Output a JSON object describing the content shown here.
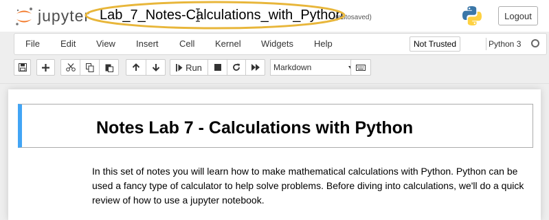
{
  "header": {
    "logo_text": "jupyter",
    "notebook_title": "Lab_7_Notes-Calculations_with_Python",
    "autosave_status": "(autosaved)",
    "logout_label": "Logout"
  },
  "menubar": {
    "items": [
      "File",
      "Edit",
      "View",
      "Insert",
      "Cell",
      "Kernel",
      "Widgets",
      "Help"
    ],
    "trust_label": "Not Trusted",
    "kernel_name": "Python 3"
  },
  "toolbar": {
    "run_label": "Run",
    "cell_type": "Markdown",
    "icons": [
      "save-icon",
      "plus-icon",
      "cut-icon",
      "copy-icon",
      "paste-icon",
      "arrow-up-icon",
      "arrow-down-icon",
      "run-icon",
      "stop-icon",
      "restart-icon",
      "fast-forward-icon",
      "keyboard-icon"
    ]
  },
  "cell": {
    "heading": "Notes Lab 7 - Calculations with Python",
    "paragraph": "In this set of notes you will learn how to make mathematical calculations with Python. Python can be used a fancy type of calculator to help solve problems. Before diving into calculations, we'll do a quick review of how to use a jupyter notebook."
  },
  "colors": {
    "jupyter_orange": "#f37726",
    "highlight_ellipse": "#e8b63a",
    "cell_selected_bar": "#42a5f5"
  }
}
